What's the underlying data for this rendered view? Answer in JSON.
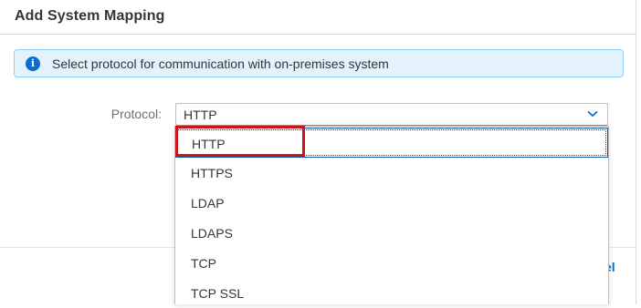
{
  "dialog": {
    "title": "Add System Mapping",
    "info_message": "Select protocol for communication with on-premises system",
    "info_icon": "info-icon",
    "colors": {
      "accent": "#0a6ed1",
      "info_background": "#e4f2fc",
      "highlight": "#d0121b"
    }
  },
  "form": {
    "protocol_label": "Protocol:",
    "protocol_value": "HTTP",
    "chevron_icon": "chevron-down-icon"
  },
  "dropdown": {
    "options": [
      "HTTP",
      "HTTPS",
      "LDAP",
      "LDAPS",
      "TCP",
      "TCP SSL"
    ],
    "selected": "HTTP"
  },
  "footer": {
    "cancel_label_fragment": "el"
  }
}
